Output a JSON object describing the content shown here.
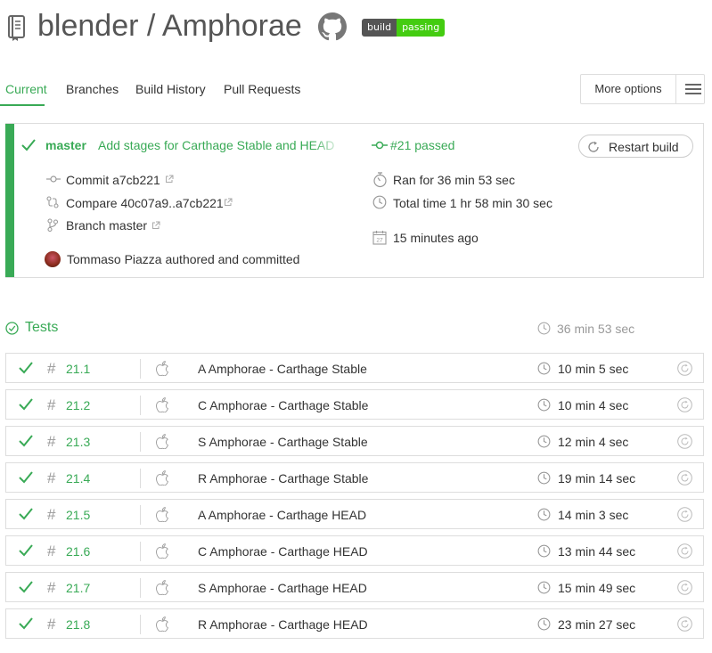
{
  "header": {
    "owner": "blender",
    "separator": " / ",
    "repo": "Amphorae",
    "badge_left": "build",
    "badge_right": "passing"
  },
  "tabs": [
    {
      "label": "Current",
      "active": true
    },
    {
      "label": "Branches",
      "active": false
    },
    {
      "label": "Build History",
      "active": false
    },
    {
      "label": "Pull Requests",
      "active": false
    }
  ],
  "more_options_label": "More options",
  "build": {
    "branch": "master",
    "message": "Add stages for Carthage Stable and HEAD",
    "status": "#21 passed",
    "restart_label": "Restart build",
    "commit": "Commit a7cb221",
    "compare": "Compare 40c07a9..a7cb221",
    "branch_link": "Branch master",
    "ran_for": "Ran for 36 min 53 sec",
    "total_time": "Total time 1 hr 58 min 30 sec",
    "ago": "15 minutes ago",
    "author": "Tommaso Piazza authored and committed",
    "calendar_day": "27"
  },
  "tests": {
    "title": "Tests",
    "duration": "36 min 53 sec",
    "jobs": [
      {
        "number": "21.1",
        "name": "A Amphorae - Carthage Stable",
        "duration": "10 min 5 sec"
      },
      {
        "number": "21.2",
        "name": "C Amphorae - Carthage Stable",
        "duration": "10 min 4 sec"
      },
      {
        "number": "21.3",
        "name": "S Amphorae - Carthage Stable",
        "duration": "12 min 4 sec"
      },
      {
        "number": "21.4",
        "name": "R Amphorae - Carthage Stable",
        "duration": "19 min 14 sec"
      },
      {
        "number": "21.5",
        "name": "A Amphorae - Carthage HEAD",
        "duration": "14 min 3 sec"
      },
      {
        "number": "21.6",
        "name": "C Amphorae - Carthage HEAD",
        "duration": "13 min 44 sec"
      },
      {
        "number": "21.7",
        "name": "S Amphorae - Carthage HEAD",
        "duration": "15 min 49 sec"
      },
      {
        "number": "21.8",
        "name": "R Amphorae - Carthage HEAD",
        "duration": "23 min 27 sec"
      }
    ]
  },
  "colors": {
    "accent": "#39aa56",
    "badge_left": "#555555",
    "badge_right": "#44cc11"
  },
  "icons": [
    "repo-icon",
    "github-icon",
    "check-icon",
    "commit-icon",
    "compare-icon",
    "branch-icon",
    "external-link-icon",
    "stopwatch-icon",
    "clock-icon",
    "calendar-icon",
    "restart-icon",
    "apple-icon",
    "menu-icon"
  ]
}
